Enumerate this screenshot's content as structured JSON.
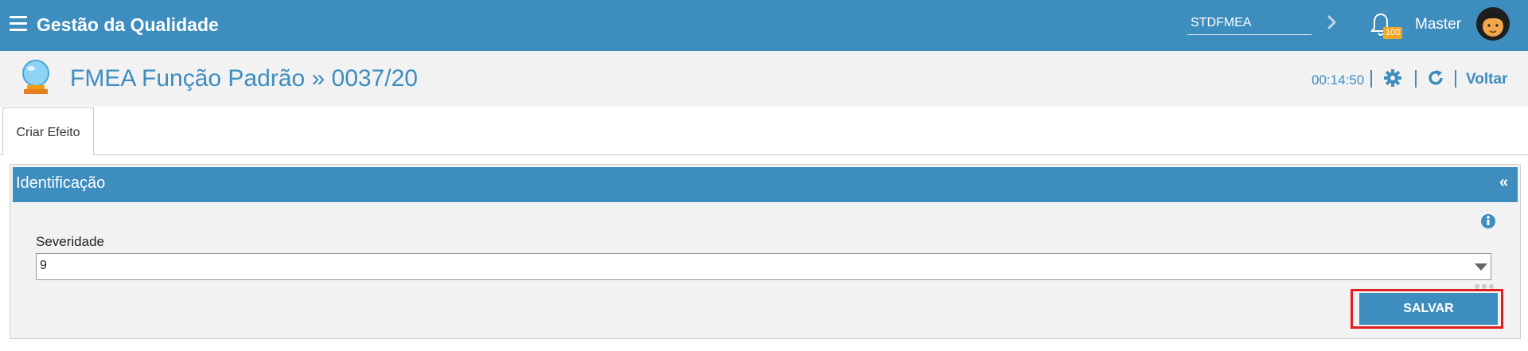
{
  "header": {
    "app_title": "Gestão da Qualidade",
    "module_code": "STDFMEA",
    "notification_count": "100",
    "user_name": "Master"
  },
  "titlebar": {
    "page_title": "FMEA Função Padrão » 0037/20",
    "timer": "00:14:50",
    "back_label": "Voltar"
  },
  "tabs": [
    {
      "label": "Criar Efeito",
      "active": true
    }
  ],
  "panel": {
    "title": "Identificação",
    "collapse_symbol": "«",
    "field": {
      "label": "Severidade",
      "value": "9"
    },
    "save_label": "SALVAR"
  },
  "colors": {
    "primary": "#3d8dbf",
    "badge": "#f5a623",
    "highlight": "#e01e1e"
  },
  "icons": [
    "menu-icon",
    "chevron-right-icon",
    "bell-icon",
    "avatar",
    "crystal-ball-icon",
    "gear-icon",
    "refresh-icon",
    "info-icon",
    "dropdown-arrow-icon"
  ]
}
